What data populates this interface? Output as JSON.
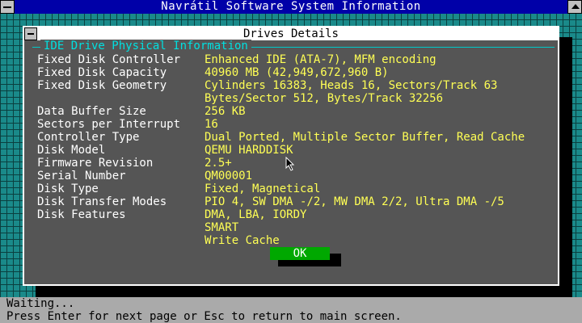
{
  "window": {
    "title": "Navrátil Software System Information"
  },
  "dialog": {
    "title": "Drives Details",
    "group_title": "IDE Drive Physical Information",
    "rows": [
      {
        "label": "Fixed Disk Controller",
        "value": "Enhanced IDE (ATA-7), MFM encoding"
      },
      {
        "label": "Fixed Disk Capacity",
        "value": "40960 MB (42,949,672,960 B)"
      },
      {
        "label": "Fixed Disk Geometry",
        "value": "Cylinders 16383, Heads 16, Sectors/Track 63"
      },
      {
        "label": "",
        "value": "Bytes/Sector 512, Bytes/Track 32256"
      },
      {
        "label": "Data Buffer Size",
        "value": "256 KB"
      },
      {
        "label": "Sectors per Interrupt",
        "value": "16"
      },
      {
        "label": "Controller Type",
        "value": "Dual Ported, Multiple Sector Buffer, Read Cache"
      },
      {
        "label": "Disk Model",
        "value": "QEMU HARDDISK"
      },
      {
        "label": "Firmware Revision",
        "value": "2.5+"
      },
      {
        "label": "Serial Number",
        "value": "QM00001"
      },
      {
        "label": "Disk Type",
        "value": "Fixed, Magnetical"
      },
      {
        "label": "Disk Transfer Modes",
        "value": "PIO 4, SW DMA -/2, MW DMA 2/2, Ultra DMA -/5"
      },
      {
        "label": "Disk Features",
        "value": "DMA, LBA, IORDY"
      },
      {
        "label": "",
        "value": "SMART"
      },
      {
        "label": "",
        "value": "Write Cache"
      }
    ],
    "ok_label": "OK"
  },
  "status": {
    "line1": "Waiting...",
    "line2": "Press Enter for next page or Esc to return to main screen."
  },
  "colors": {
    "title_bar": "#0000a8",
    "desktop": "#1a8a8a",
    "dialog_bg": "#555555",
    "value_text": "#ffff55",
    "group_title": "#00e0e0",
    "ok_button": "#00a800",
    "status_bar": "#aaaaaa"
  }
}
